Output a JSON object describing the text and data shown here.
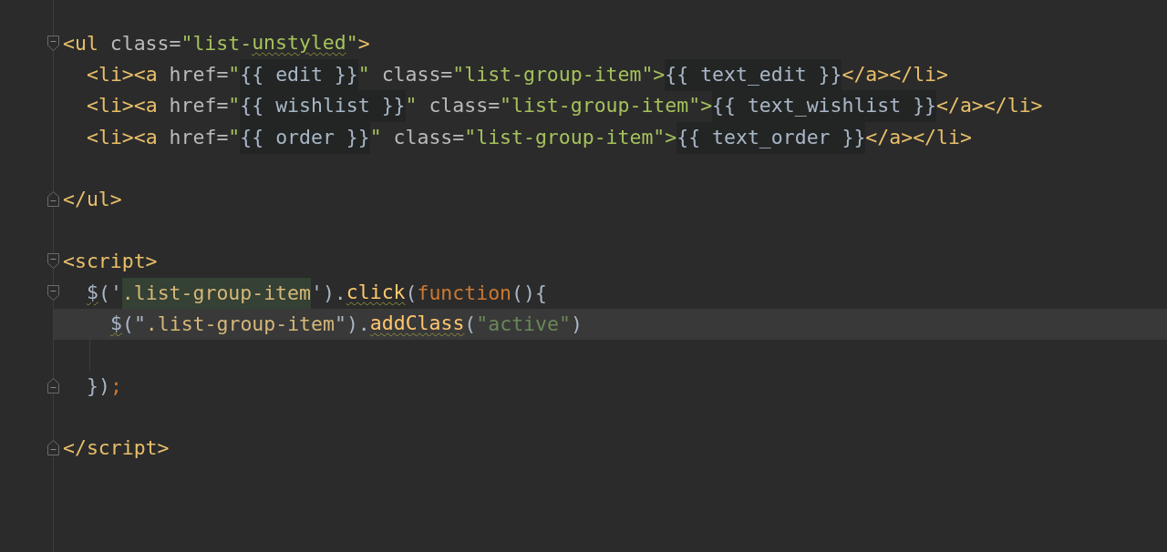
{
  "editor": {
    "lines": [
      {
        "fold_open": true,
        "current": false,
        "tokens": [
          {
            "text": "<ul",
            "kind": "tag"
          },
          {
            "text": " class",
            "kind": "attr"
          },
          {
            "text": "=",
            "kind": "attr"
          },
          {
            "text": "\"list-",
            "kind": "str"
          },
          {
            "text": "unstyled",
            "kind": "str",
            "warning": true
          },
          {
            "text": "\"",
            "kind": "str"
          },
          {
            "text": ">",
            "kind": "tag"
          }
        ],
        "children": [
          {
            "current": false,
            "tokens": [
              {
                "text": "<li><a",
                "kind": "tag"
              },
              {
                "text": " href=",
                "kind": "attr"
              },
              {
                "text": "\"",
                "kind": "str"
              },
              {
                "text": "{{ edit }}",
                "kind": "tpl"
              },
              {
                "text": "\"",
                "kind": "str"
              },
              {
                "text": " class=",
                "kind": "attr"
              },
              {
                "text": "\"list-group-item\">",
                "kind": "str"
              },
              {
                "text": "{{ text_edit }}",
                "kind": "tpl"
              },
              {
                "text": "</a></li>",
                "kind": "tag"
              }
            ]
          },
          {
            "current": false,
            "tokens": [
              {
                "text": "<li><a",
                "kind": "tag"
              },
              {
                "text": " href=",
                "kind": "attr"
              },
              {
                "text": "\"",
                "kind": "str"
              },
              {
                "text": "{{ wishlist }}",
                "kind": "tpl"
              },
              {
                "text": "\"",
                "kind": "str"
              },
              {
                "text": " class=",
                "kind": "attr"
              },
              {
                "text": "\"list-group-item\">",
                "kind": "str"
              },
              {
                "text": "{{ text_wishlist }}",
                "kind": "tpl"
              },
              {
                "text": "</a></li>",
                "kind": "tag"
              }
            ]
          },
          {
            "current": false,
            "tokens": [
              {
                "text": "<li><a",
                "kind": "tag"
              },
              {
                "text": " href=",
                "kind": "attr"
              },
              {
                "text": "\"",
                "kind": "str"
              },
              {
                "text": "{{ order }}",
                "kind": "tpl"
              },
              {
                "text": "\"",
                "kind": "str"
              },
              {
                "text": " class=",
                "kind": "attr"
              },
              {
                "text": "\"list-group-item\">",
                "kind": "str"
              },
              {
                "text": "{{ text_order }}",
                "kind": "tpl"
              },
              {
                "text": "</a></li>",
                "kind": "tag"
              }
            ]
          }
        ]
      },
      {
        "current": false
      },
      {
        "fold_close": true,
        "current": false,
        "tokens": [
          {
            "text": "</ul>",
            "kind": "tag"
          }
        ]
      },
      {
        "current": false
      },
      {
        "fold_open": true,
        "current": false,
        "tokens": [
          {
            "text": "<script>",
            "kind": "tag"
          }
        ],
        "children": [
          {
            "fold_open": true,
            "current": false,
            "tokens": [
              {
                "text": "$",
                "kind": "plain",
                "warning": true
              },
              {
                "text": "('",
                "kind": "plain"
              },
              {
                "text": ".list-group-item",
                "kind": "sel",
                "selected": true
              },
              {
                "text": "').",
                "kind": "plain"
              },
              {
                "text": "click",
                "kind": "fn",
                "warning": true
              },
              {
                "text": "(",
                "kind": "plain"
              },
              {
                "text": "function",
                "kind": "kw"
              },
              {
                "text": "(){",
                "kind": "plain"
              }
            ],
            "children": [
              {
                "current": true,
                "tokens": [
                  {
                    "text": "$",
                    "kind": "plain",
                    "warning": true
                  },
                  {
                    "text": "(\"",
                    "kind": "plain"
                  },
                  {
                    "text": ".list-group-item",
                    "kind": "sel",
                    "selected": false
                  },
                  {
                    "text": "\").",
                    "kind": "plain"
                  },
                  {
                    "text": "addClass",
                    "kind": "fn",
                    "warning": true
                  },
                  {
                    "text": "(",
                    "kind": "plain"
                  },
                  {
                    "text": "\"active\"",
                    "kind": "jsstr"
                  },
                  {
                    "text": ")",
                    "kind": "plain"
                  }
                ]
              },
              {
                "current": false,
                "indent_guide": true
              }
            ]
          },
          {
            "fold_close": true,
            "current": false,
            "tokens": [
              {
                "text": "})",
                "kind": "plain"
              },
              {
                "text": ";",
                "kind": "kw"
              }
            ]
          }
        ]
      },
      {
        "current": false
      },
      {
        "fold_close": true,
        "current": false,
        "tokens": [
          {
            "text": "</script>",
            "kind": "tag"
          }
        ]
      }
    ]
  }
}
